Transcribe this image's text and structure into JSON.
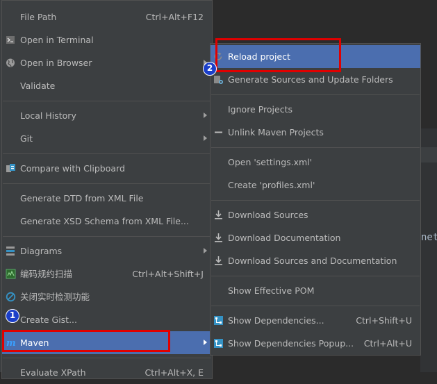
{
  "main_menu": {
    "items": [
      {
        "label": "File Path",
        "shortcut": "Ctrl+Alt+F12"
      },
      {
        "label": "Open in Terminal"
      },
      {
        "label": "Open in Browser"
      },
      {
        "label": "Validate"
      },
      {
        "label": "Local History"
      },
      {
        "label": "Git"
      },
      {
        "label": "Compare with Clipboard"
      },
      {
        "label": "Generate DTD from XML File"
      },
      {
        "label": "Generate XSD Schema from XML File..."
      },
      {
        "label": "Diagrams"
      },
      {
        "label": "编码规约扫描",
        "shortcut": "Ctrl+Alt+Shift+J"
      },
      {
        "label": "关闭实时检测功能"
      },
      {
        "label": "Create Gist..."
      },
      {
        "label": "Maven"
      },
      {
        "label": "Evaluate XPath",
        "shortcut": "Ctrl+Alt+X, E"
      }
    ]
  },
  "maven_submenu": {
    "items": [
      {
        "label": "Reload project"
      },
      {
        "label": "Generate Sources and Update Folders"
      },
      {
        "label": "Ignore Projects"
      },
      {
        "label": "Unlink Maven Projects"
      },
      {
        "label": "Open 'settings.xml'"
      },
      {
        "label": "Create 'profiles.xml'"
      },
      {
        "label": "Download Sources"
      },
      {
        "label": "Download Documentation"
      },
      {
        "label": "Download Sources and Documentation"
      },
      {
        "label": "Show Effective POM"
      },
      {
        "label": "Show Dependencies...",
        "shortcut": "Ctrl+Shift+U"
      },
      {
        "label": "Show Dependencies Popup...",
        "shortcut": "Ctrl+Alt+U"
      }
    ]
  },
  "annotations": {
    "step1": "1",
    "step2": "2"
  },
  "background_fragment": "net",
  "colors": {
    "menu_bg": "#3c3f41",
    "selection": "#4b6eaf",
    "highlight": "#e00000",
    "badge": "#1b3fc9"
  }
}
